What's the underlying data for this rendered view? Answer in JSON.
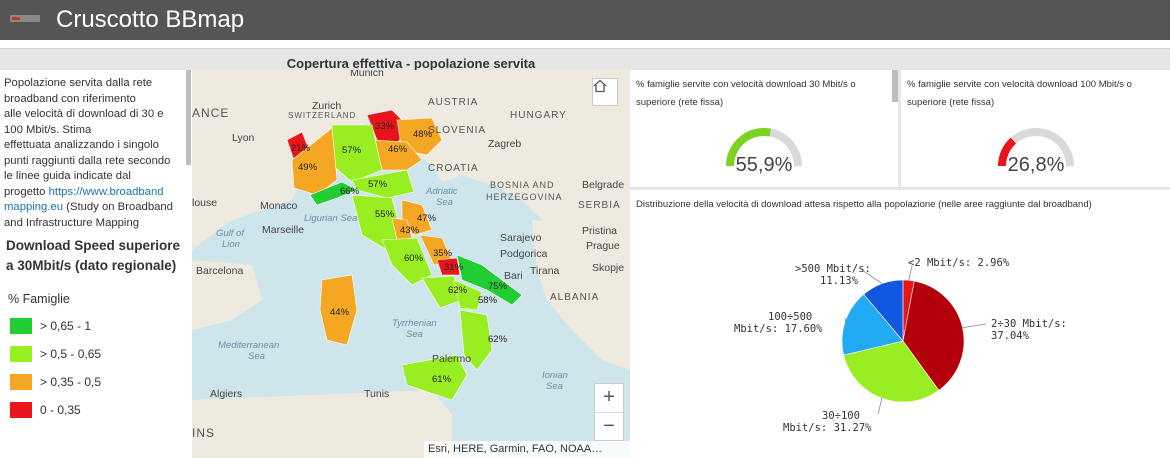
{
  "header": {
    "title": "Cruscotto BBmap"
  },
  "map_title": "Copertura effettiva - popolazione servita",
  "left_panel": {
    "desc_lines": [
      "Popolazione servita dalla rete",
      "broadband con riferimento",
      "alle velocità di download di 30 e",
      "100 Mbit/s. Stima",
      "effettuata analizzando i singolo",
      "punti raggiunti dalla rete secondo",
      "le linee guida indicate dal"
    ],
    "desc_link_prefix": "progetto ",
    "desc_link_line1": "https://www.broadband",
    "desc_link_line2": "mapping.eu",
    "desc_suffix1": " (Study on Broadband",
    "desc_suffix2": "and Infrastructure Mapping",
    "legend_title": "Download Speed superiore a 30Mbit/s (dato regionale)",
    "legend_subtitle": "% Famiglie",
    "legend_items": [
      {
        "label": "> 0,65 - 1",
        "color": "#22cc33"
      },
      {
        "label": "> 0,5 - 0,65",
        "color": "#99ee22"
      },
      {
        "label": "> 0,35 - 0,5",
        "color": "#f5a623"
      },
      {
        "label": "0 - 0,35",
        "color": "#e8161b"
      }
    ]
  },
  "map": {
    "attribution": "Esri, HERE, Garmin, FAO, NOAA…",
    "zoom_in": "+",
    "zoom_out": "−",
    "cities": [
      "Munich",
      "Zurich",
      "Lyon",
      "Monaco",
      "Marseille",
      "Barcelona",
      "Algiers",
      "Tunis",
      "Zagreb",
      "Belgrade",
      "Sarajevo",
      "Podgorica",
      "Tirana",
      "Bari",
      "Palermo",
      "Pristina",
      "Skopje",
      "Prague",
      "louse"
    ],
    "countries": [
      "AUSTRIA",
      "SLOVENIA",
      "HUNGARY",
      "CROATIA",
      "BOSNIA AND",
      "HERZEGOVINA",
      "SERBIA",
      "ALBANIA",
      "SWITZERLAND",
      "ANCE",
      "INS"
    ],
    "seas": [
      "Ligurian Sea",
      "Adriatic",
      "Sea",
      "Gulf of",
      "Lion",
      "Mediterranean",
      "Sea",
      "Tyrrhenian",
      "Sea",
      "Ionian",
      "Sea"
    ],
    "region_values": [
      "33%",
      "48%",
      "21%",
      "57%",
      "46%",
      "49%",
      "66%",
      "57%",
      "55%",
      "47%",
      "43%",
      "60%",
      "35%",
      "31%",
      "75%",
      "62%",
      "58%",
      "44%",
      "62%",
      "61%"
    ]
  },
  "gauge30": {
    "title": "% famiglie servite con velocità download 30 Mbit/s o superiore (rete fissa)",
    "value": "55,9%",
    "fraction": 0.559,
    "color": "#7ed321"
  },
  "gauge100": {
    "title": "% famiglie servite con velocità download 100 Mbit/s o superiore (rete fissa)",
    "value": "26,8%",
    "fraction": 0.268,
    "color": "#e8161b"
  },
  "pie": {
    "title": "Distribuzione della velocità di download attesa rispetto alla popolazione (nelle aree raggiunte dal broadband)",
    "label_lt2": "<2 Mbit/s: 2.96%",
    "label_2_30_a": "2÷30 Mbit/s:",
    "label_2_30_b": "37.04%",
    "label_30_100_a": "30÷100",
    "label_30_100_b": "Mbit/s: 31.27%",
    "label_100_500_a": "100÷500",
    "label_100_500_b": "Mbit/s: 17.60%",
    "label_500_a": ">500 Mbit/s:",
    "label_500_b": "11.13%"
  },
  "chart_data": {
    "type": "pie",
    "title": "Distribuzione della velocità di download attesa rispetto alla popolazione (nelle aree raggiunte dal broadband)",
    "categories": [
      "<2 Mbit/s",
      "2÷30 Mbit/s",
      "30÷100 Mbit/s",
      "100÷500 Mbit/s",
      ">500 Mbit/s"
    ],
    "values": [
      2.96,
      37.04,
      31.27,
      17.6,
      11.13
    ],
    "colors": [
      "#e8161b",
      "#b3000a",
      "#99ee22",
      "#22aaf5",
      "#1257e0"
    ]
  }
}
